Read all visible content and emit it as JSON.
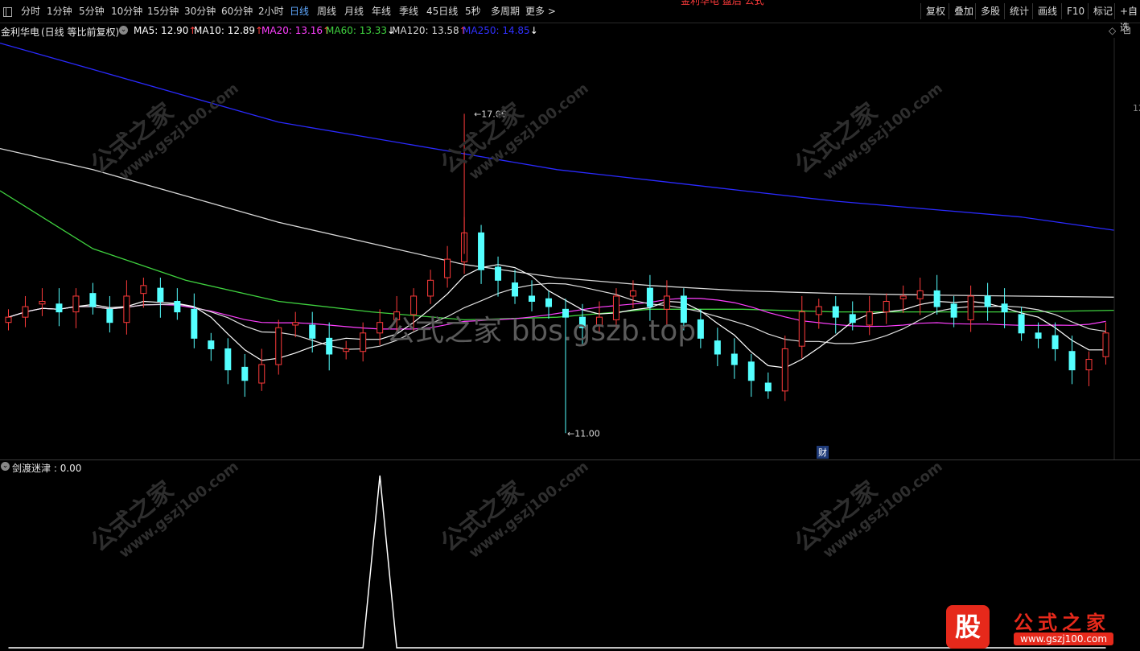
{
  "toolbar": {
    "periods": [
      "分时",
      "1分钟",
      "5分钟",
      "10分钟",
      "15分钟",
      "30分钟",
      "60分钟",
      "2小时",
      "日线",
      "周线",
      "月线",
      "年线",
      "季线",
      "45日线",
      "5秒",
      "多周期",
      "更多 >"
    ],
    "active_period": "日线",
    "right_buttons": [
      "复权",
      "叠加",
      "多股",
      "统计",
      "画线",
      "F10",
      "标记",
      "+自选"
    ],
    "title_text": "金利华电 盘后 公式"
  },
  "info": {
    "stock": "金利华电",
    "mode": "(日线 等比前复权)",
    "ma5": "MA5: 12.90",
    "ma10": "MA10: 12.89",
    "ma20": "MA20: 13.16",
    "ma60": "MA60: 13.33",
    "ma120": "MA120: 13.58",
    "ma250": "MA250: 14.85",
    "ma5_arrow": "↑",
    "ma10_arrow": "↑",
    "ma20_arrow": "↑",
    "ma60_arrow": "↓",
    "ma120_arrow": "↑",
    "ma250_arrow": "↓",
    "colors": {
      "ma5": "#ffffff",
      "ma10": "#ffffff",
      "ma20": "#ff3fff",
      "ma60": "#3fd23f",
      "ma120": "#d8d8d8",
      "ma250": "#2a2aff"
    }
  },
  "chart_data": {
    "type": "candlestick",
    "high_label": "17.06",
    "low_label": "11.00",
    "finance_marker": "财",
    "ylim": [
      10.5,
      18.5
    ],
    "ma250": [
      18.4,
      17.9,
      17.4,
      16.9,
      16.6,
      16.3,
      16.0,
      15.8,
      15.6,
      15.4,
      15.25,
      15.1,
      14.85
    ],
    "ma120": [
      16.4,
      16.0,
      15.5,
      15.0,
      14.6,
      14.2,
      13.95,
      13.8,
      13.7,
      13.65,
      13.62,
      13.6,
      13.58
    ],
    "ma60": [
      15.6,
      14.5,
      13.9,
      13.5,
      13.3,
      13.15,
      13.2,
      13.35,
      13.35,
      13.3,
      13.3,
      13.3,
      13.33
    ],
    "closes": [
      13.2,
      13.4,
      13.5,
      13.3,
      13.6,
      13.4,
      13.1,
      13.6,
      13.8,
      13.5,
      13.3,
      12.8,
      12.6,
      12.2,
      12.0,
      12.3,
      13.0,
      13.1,
      12.8,
      12.5,
      12.6,
      12.9,
      13.1,
      13.3,
      13.6,
      13.9,
      14.3,
      14.8,
      14.1,
      13.9,
      13.6,
      13.5,
      13.4,
      13.2,
      13.0,
      13.2,
      13.6,
      13.7,
      13.4,
      13.6,
      13.1,
      12.8,
      12.5,
      12.3,
      12.0,
      11.8,
      12.6,
      13.3,
      13.4,
      13.2,
      13.1,
      13.3,
      13.5,
      13.6,
      13.7,
      13.4,
      13.2,
      13.6,
      13.4,
      13.3,
      12.9,
      12.8,
      12.6,
      12.2,
      12.4,
      12.9
    ]
  },
  "sub": {
    "indicator": "剑渡迷津",
    "value": "0.00",
    "signals": [
      0,
      0,
      0,
      0,
      0,
      0,
      0,
      0,
      0,
      0,
      0,
      0,
      0,
      0,
      0,
      0,
      0,
      0,
      0,
      0,
      0,
      0,
      1,
      0,
      0,
      0,
      0,
      0,
      0,
      0,
      0,
      0,
      0,
      0,
      0,
      0,
      0,
      0,
      0,
      0,
      0,
      0,
      0,
      0,
      0,
      0,
      0,
      0,
      0,
      0,
      0,
      0,
      0,
      0,
      0,
      0,
      0,
      0,
      0,
      0,
      0,
      0,
      0,
      0,
      0,
      0
    ]
  },
  "watermark": {
    "name": "公式之家",
    "url": "www.gszj100.com",
    "bbs": "公式之家 bbs.gszb.top"
  },
  "logo": {
    "glyph": "股",
    "name": "公式之家",
    "url": "www.gszj100.com"
  }
}
